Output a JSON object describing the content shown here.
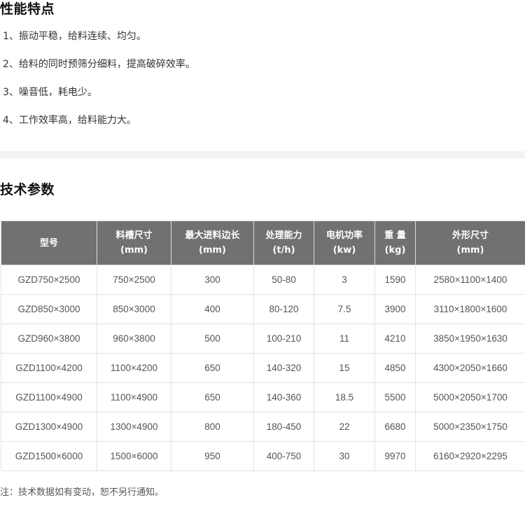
{
  "features": {
    "title": "性能特点",
    "items": [
      "1、振动平稳，给料连续、均匀。",
      "2、给料的同时预筛分细料，提高破碎效率。",
      "3、噪音低，耗电少。",
      "4、工作效率高，给料能力大。"
    ]
  },
  "specs": {
    "title": "技术参数",
    "headers": [
      {
        "line1": "型号",
        "line2": ""
      },
      {
        "line1": "料槽尺寸",
        "line2": "(mm)"
      },
      {
        "line1": "最大进料边长",
        "line2": "(mm)"
      },
      {
        "line1": "处理能力",
        "line2": "(t/h)"
      },
      {
        "line1": "电机功率",
        "line2": "(kw)"
      },
      {
        "line1": "重 量",
        "line2": "(kg)"
      },
      {
        "line1": "外形尺寸",
        "line2": "(mm)"
      }
    ],
    "rows": [
      [
        "GZD750×2500",
        "750×2500",
        "300",
        "50-80",
        "3",
        "1590",
        "2580×1100×1400"
      ],
      [
        "GZD850×3000",
        "850×3000",
        "400",
        "80-120",
        "7.5",
        "3900",
        "3110×1800×1600"
      ],
      [
        "GZD960×3800",
        "960×3800",
        "500",
        "100-210",
        "11",
        "4210",
        "3850×1950×1630"
      ],
      [
        "GZD1100×4200",
        "1100×4200",
        "650",
        "140-320",
        "15",
        "4850",
        "4300×2050×1660"
      ],
      [
        "GZD1100×4900",
        "1100×4900",
        "650",
        "140-360",
        "18.5",
        "5500",
        "5000×2050×1700"
      ],
      [
        "GZD1300×4900",
        "1300×4900",
        "800",
        "180-450",
        "22",
        "6680",
        "5000×2350×1750"
      ],
      [
        "GZD1500×6000",
        "1500×6000",
        "950",
        "400-750",
        "30",
        "9970",
        "6160×2920×2295"
      ]
    ]
  },
  "note": "注：技术数据如有变动，恕不另行通知。",
  "colors": {
    "header_bg": "#717171",
    "header_text": "#ffffff",
    "divider": "#f2f2f2"
  }
}
